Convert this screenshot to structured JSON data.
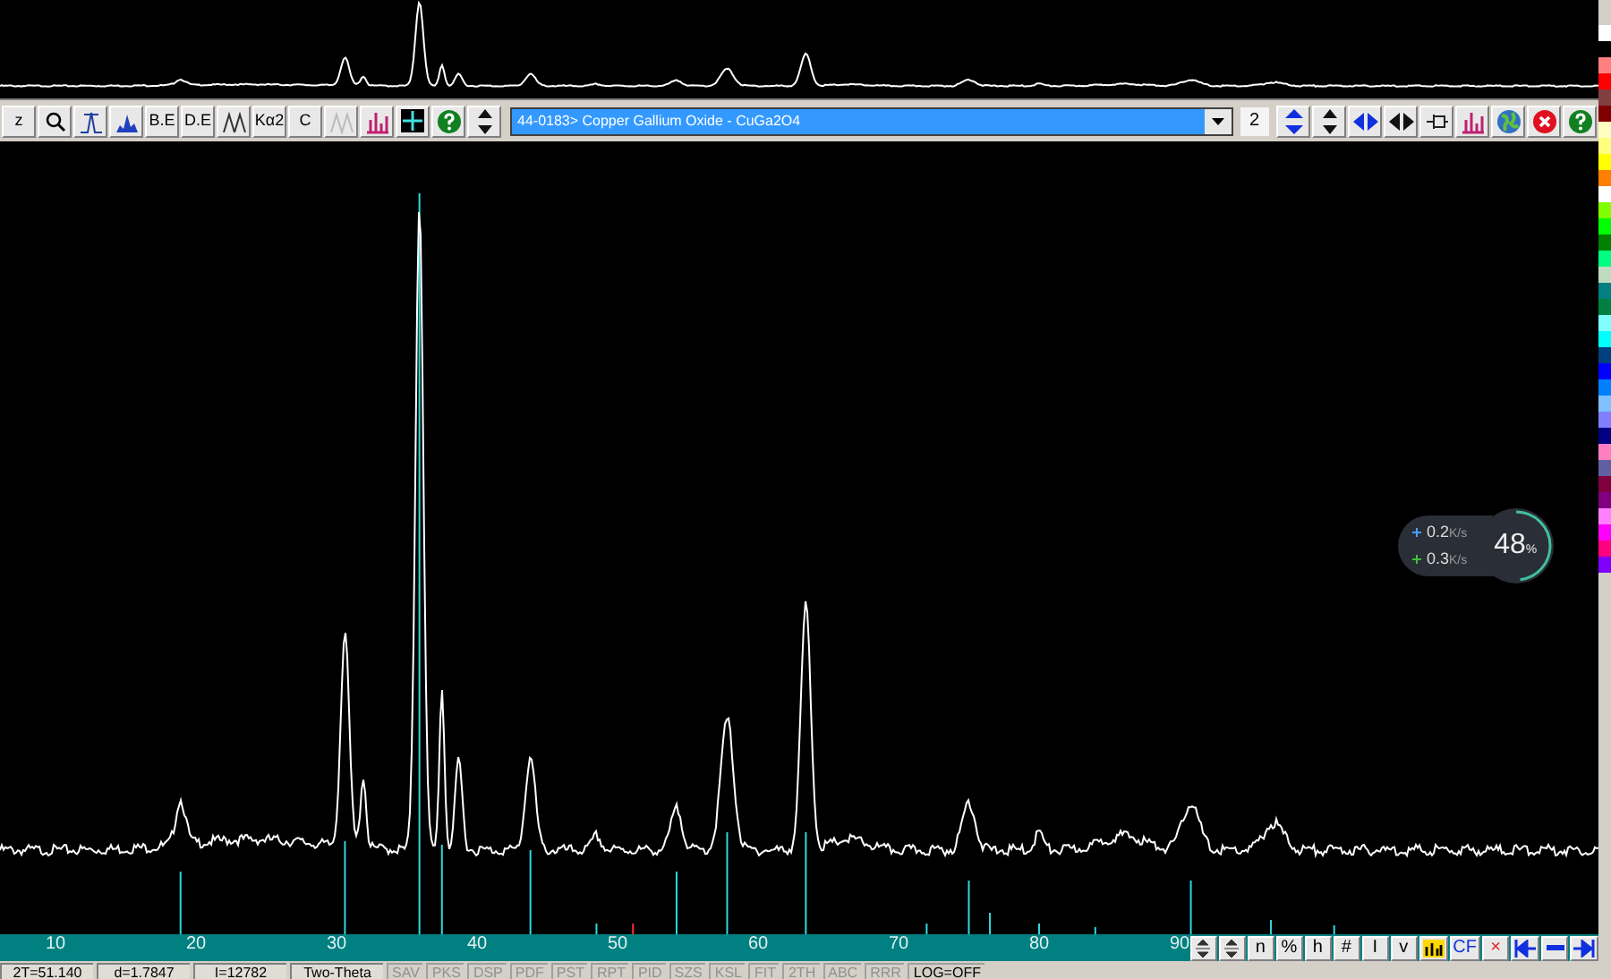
{
  "toolbar": {
    "left_buttons": [
      {
        "kind": "text",
        "label": "z"
      },
      {
        "kind": "zoom"
      },
      {
        "kind": "peaks"
      },
      {
        "kind": "fill"
      },
      {
        "kind": "text",
        "label": "B.E"
      },
      {
        "kind": "text",
        "label": "D.E"
      },
      {
        "kind": "waves"
      },
      {
        "kind": "text",
        "label": "Kα2"
      },
      {
        "kind": "text",
        "label": "C"
      },
      {
        "kind": "faded"
      },
      {
        "kind": "bars"
      },
      {
        "kind": "grid"
      },
      {
        "kind": "help"
      },
      {
        "kind": "updown"
      }
    ],
    "phase_select": {
      "value": "44-0183> Copper Gallium Oxide - CuGa2O4"
    },
    "count": "2",
    "right_buttons": [
      {
        "kind": "blueupdown"
      },
      {
        "kind": "updown"
      },
      {
        "kind": "blueleftright"
      },
      {
        "kind": "leftright"
      },
      {
        "kind": "pin"
      },
      {
        "kind": "bars"
      },
      {
        "kind": "globe"
      },
      {
        "kind": "close"
      },
      {
        "kind": "help"
      }
    ]
  },
  "axis": {
    "labels": [
      "10",
      "20",
      "30",
      "40",
      "50",
      "60",
      "70",
      "80",
      "90"
    ],
    "buttons": [
      {
        "kind": "spin"
      },
      {
        "kind": "spin"
      },
      {
        "kind": "text",
        "label": "n"
      },
      {
        "kind": "text",
        "label": "%"
      },
      {
        "kind": "text",
        "label": "h"
      },
      {
        "kind": "text",
        "label": "#"
      },
      {
        "kind": "text",
        "label": "I"
      },
      {
        "kind": "text",
        "label": "v"
      },
      {
        "kind": "chart"
      },
      {
        "kind": "text",
        "label": "CF"
      },
      {
        "kind": "text",
        "label": "×"
      },
      {
        "kind": "left"
      },
      {
        "kind": "minus"
      },
      {
        "kind": "right"
      }
    ]
  },
  "status_bar": [
    {
      "kind": "field",
      "label": "2T=51.140",
      "disabled": false
    },
    {
      "kind": "field",
      "label": "d=1.7847",
      "disabled": false
    },
    {
      "kind": "field",
      "label": "I=12782",
      "disabled": false
    },
    {
      "kind": "field",
      "label": "Two-Theta",
      "disabled": false
    },
    {
      "kind": "button",
      "label": "SAV",
      "disabled": true
    },
    {
      "kind": "button",
      "label": "PKS",
      "disabled": true
    },
    {
      "kind": "button",
      "label": "DSP",
      "disabled": true
    },
    {
      "kind": "button",
      "label": "PDF",
      "disabled": true
    },
    {
      "kind": "button",
      "label": "PST",
      "disabled": true
    },
    {
      "kind": "button",
      "label": "RPT",
      "disabled": true
    },
    {
      "kind": "button",
      "label": "PID",
      "disabled": true
    },
    {
      "kind": "button",
      "label": "SZS",
      "disabled": true
    },
    {
      "kind": "button",
      "label": "KSL",
      "disabled": true
    },
    {
      "kind": "button",
      "label": "FIT",
      "disabled": true
    },
    {
      "kind": "button",
      "label": "2TH",
      "disabled": true
    },
    {
      "kind": "button",
      "label": "ABC",
      "disabled": true
    },
    {
      "kind": "button",
      "label": "RRR",
      "disabled": true
    },
    {
      "kind": "button",
      "label": "LOG=OFF",
      "disabled": false
    }
  ],
  "speed_widget": {
    "upload": "0.2",
    "upload_unit": "K/s",
    "download": "0.3",
    "download_unit": "K/s",
    "percent": "48",
    "percent_unit": "%",
    "level": 0.48
  },
  "palette": [
    {
      "color": "#ffffff"
    },
    {
      "color": "#000000"
    },
    {
      "color": "#ff8080"
    },
    {
      "color": "#ff0000"
    },
    {
      "color": "#804040"
    },
    {
      "color": "#800000"
    },
    {
      "color": "#ffffc0"
    },
    {
      "color": "#ffff80"
    },
    {
      "color": "#ffff00"
    },
    {
      "color": "#ff8000"
    },
    {
      "color": "#ffffff"
    },
    {
      "color": "#80ff00"
    },
    {
      "color": "#00ff00"
    },
    {
      "color": "#008000"
    },
    {
      "color": "#00ff80"
    },
    {
      "color": "#c0dcc0"
    },
    {
      "color": "#008080"
    },
    {
      "color": "#008040"
    },
    {
      "color": "#80ffff"
    },
    {
      "color": "#00ffff"
    },
    {
      "color": "#004080"
    },
    {
      "color": "#0000ff"
    },
    {
      "color": "#0080ff"
    },
    {
      "color": "#80c0ff"
    },
    {
      "color": "#8080ff"
    },
    {
      "color": "#000080"
    },
    {
      "color": "#ff80c0"
    },
    {
      "color": "#6060a0"
    },
    {
      "color": "#800040"
    },
    {
      "color": "#800080"
    },
    {
      "color": "#ff80ff"
    },
    {
      "color": "#ff00ff"
    },
    {
      "color": "#ff0080"
    },
    {
      "color": "#8000ff"
    }
  ]
}
